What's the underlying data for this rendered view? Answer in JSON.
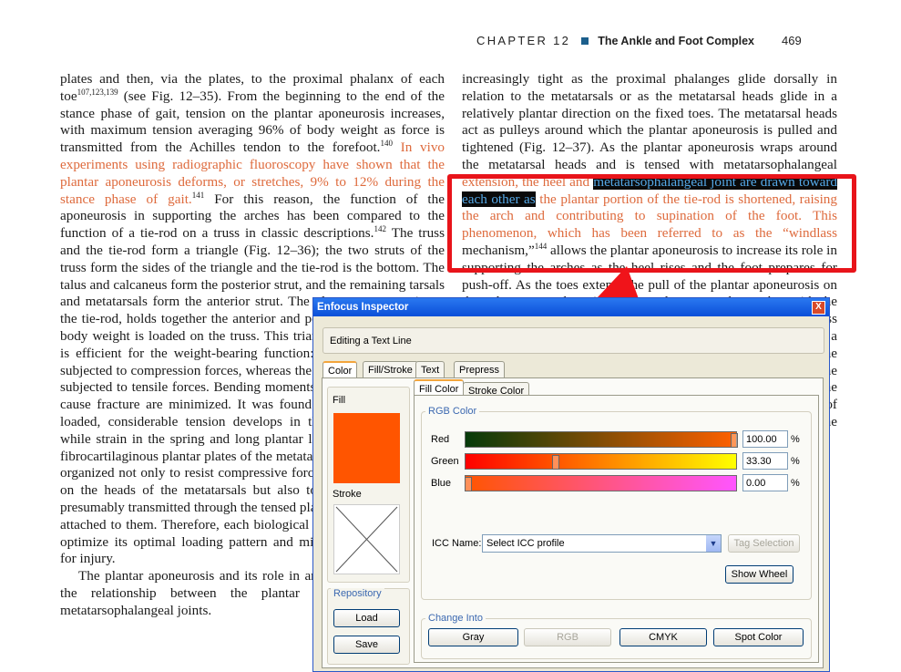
{
  "header": {
    "chapter": "CHAPTER 12",
    "title": "The Ankle and Foot Complex",
    "page": "469"
  },
  "left_column": {
    "p1_a": "plates and then, via the plates, to the proximal phalanx of each toe",
    "p1_sup1": "107,123,139",
    "p1_b": " (see Fig. 12–35). From the beginning to the end of the stance phase of gait, tension on the plantar aponeurosis increases, with maximum tension averaging 96% of body weight as force is transmitted from the Achilles tendon to the forefoot.",
    "p1_sup2": "140",
    "p1_orange": " In vivo experiments using radiographic fluoroscopy have shown that the plantar aponeurosis deforms, or stretches, 9% to 12% during the stance phase of gait.",
    "p1_sup3": "141",
    "p1_c": " For this reason, the function of the aponeurosis in supporting the arches has been compared to the function of a tie-rod on a truss in classic descriptions.",
    "p1_sup4": "142",
    "p1_d": " The truss and the tie-rod form a triangle (Fig. 12–36); the two struts of the truss form the sides of the triangle and the tie-rod is the bottom. The talus and calcaneus form the posterior strut, and the remaining tarsals and metatarsals form the anterior strut. The plantar aponeurosis, as the tie-rod, holds together the anterior and posterior struts when the body weight is loaded on the truss. This triangular structural design is efficient for the weight-bearing function: the struts (bones) are subjected to compression forces, whereas the tie-rod (aponeurosis) is subjected to tensile forces. Bending moments to the bone that might cause fracture are minimized. It was found that when the truss is loaded, considerable tension develops in the plantar aponeurosis while strain in the spring and long plantar ligaments is less.",
    "p1_sup5": "143",
    "p1_e": " The fibrocartilaginous plantar plates of the metatarsophalangeal joints are organized not only to resist compressive forces from weight-bearing on the heads of the metatarsals but also to resist tensile stresses presumably transmitted through the tensed plantar aponeurosis that is attached to them. Therefore, each biological structure is designed to optimize its optimal loading pattern and minimize the opportunity for injury.",
    "p2": "The plantar aponeurosis and its role in arch support is linked to the relationship between the plantar aponeurosis and the metatarsophalangeal joints."
  },
  "right_column": {
    "r_a": "increasingly tight as the proximal phalanges glide dorsally in relation to the metatarsals or as the metatarsal heads glide in a relatively plantar direction on the fixed toes. The metatarsal heads act as pulleys around which the plantar aponeurosis is pulled and tightened (Fig. 12–37). As the plantar aponeurosis wraps around the metatarsal heads and is tensed with metatarsophalangeal ",
    "r_orange1": "extension, the heel and",
    "r_hl": "metatarsophalangeal joint are drawn toward each other as",
    "r_orange2": " the plantar portion of the tie-rod is shortened, raising the arch and contributing to supination of the foot. This phenomenon, which has been referred to as the “windlass",
    "r_b": " mechanism,”",
    "r_sup": "144",
    "r_c": " allows the plantar aponeurosis to increase its role in supporting the arches as the heel rises and the foot prepares for push-off. As the toes extend, the pull of the plantar aponeurosis on the calcaneus tends to invert the calcaneus and, together with the metatarsal heads, raise the longitudinal arch. The windlass mechanism does not require muscular contraction; rather, it is a passive mechanism of the plantar aponeurosis that stabilizes the foot in preparation for the push-off phase of gait. Further, the tensile load within the aponeurosis increases as the metatarsophalangeal joints are extended and a greater proportion of the load is transferred to the forefoot, reducing the strain on the plantar ligaments in weight-bearing."
  },
  "dialog": {
    "title": "Enfocus Inspector",
    "close": "X",
    "editing": "Editing a Text Line",
    "tabs": [
      "Color",
      "Fill/Stroke",
      "Text",
      "Prepress"
    ],
    "subtabs": [
      "Fill Color",
      "Stroke Color"
    ],
    "fill_label": "Fill",
    "stroke_label": "Stroke",
    "fill_color": "#ff5500",
    "repository_title": "Repository",
    "load": "Load",
    "save": "Save",
    "rgb_title": "RGB Color",
    "channels": [
      {
        "label": "Red",
        "value": "100.00",
        "unit": "%"
      },
      {
        "label": "Green",
        "value": "33.30",
        "unit": "%"
      },
      {
        "label": "Blue",
        "value": "0.00",
        "unit": "%"
      }
    ],
    "icc_label": "ICC Name:",
    "icc_value": "Select ICC profile",
    "tag_selection": "Tag Selection",
    "show_wheel": "Show Wheel",
    "change_into_title": "Change Into",
    "change_buttons": [
      "Gray",
      "RGB",
      "CMYK",
      "Spot Color"
    ]
  }
}
